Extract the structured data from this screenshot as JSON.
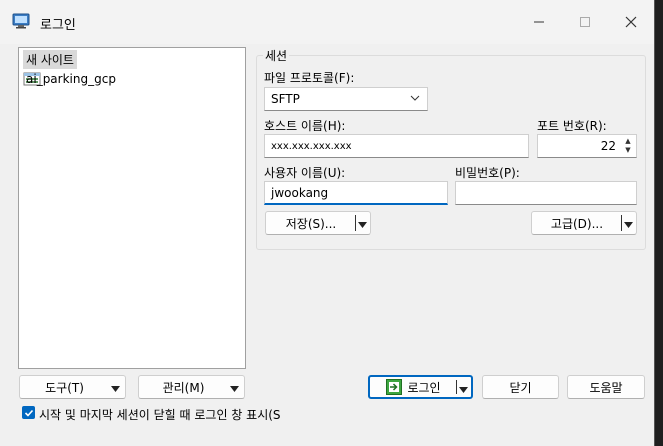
{
  "window": {
    "title": "로그인"
  },
  "sites": [
    {
      "label": "새 사이트",
      "icon": "new-site-icon",
      "selected": true
    },
    {
      "label": "ai_parking_gcp",
      "icon": "saved-site-icon",
      "selected": false
    }
  ],
  "session": {
    "title": "세션",
    "protocol_label": "파일 프로토콜(F):",
    "protocol_value": "SFTP",
    "host_label": "호스트 이름(H):",
    "host_value": "xxx.xxx.xxx.xxx",
    "port_label": "포트 번호(R):",
    "port_value": "22",
    "user_label": "사용자 이름(U):",
    "user_value": "jwookang",
    "password_label": "비밀번호(P):",
    "password_value": "",
    "save_button": "저장(S)...",
    "advanced_button": "고급(D)..."
  },
  "bottom": {
    "tools_button": "도구(T)",
    "manage_button": "관리(M)",
    "login_button": "로그인",
    "close_button": "닫기",
    "help_button": "도움말",
    "show_on_start_label": "시작 및 마지막 세션이 닫힐 때 로그인 창 표시(S",
    "show_on_start_checked": true
  },
  "colors": {
    "accent": "#0067c0",
    "background": "#f0f0f0"
  }
}
